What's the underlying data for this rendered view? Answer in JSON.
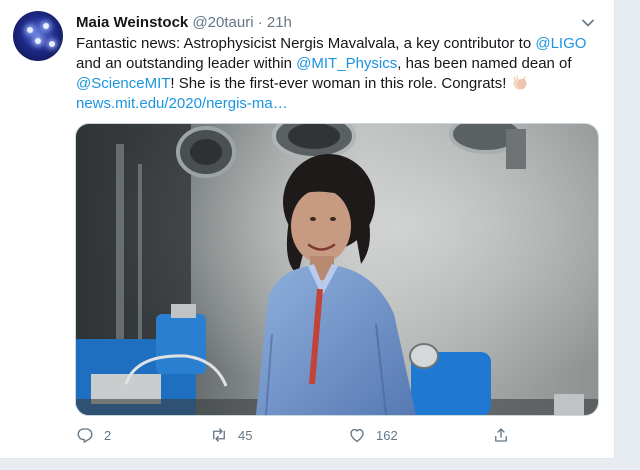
{
  "tweet": {
    "author_name": "Maia Weinstock",
    "author_handle": "@20tauri",
    "separator": "·",
    "time": "21h",
    "text": {
      "part1": "Fantastic news: Astrophysicist Nergis Mavalvala, a key contributor to ",
      "mention1": "@LIGO",
      "part2": " and an outstanding leader within ",
      "mention2": "@MIT_Physics",
      "part3": ", has been named dean of ",
      "mention3": "@ScienceMIT",
      "part4": "! She is the first-ever woman in this role. Congrats! ",
      "link": "news.mit.edu/2020/nergis-ma…"
    },
    "media_icon": "photo-woman-in-lab",
    "actions": {
      "reply_count": "2",
      "retweet_count": "45",
      "like_count": "162"
    }
  },
  "colors": {
    "link": "#1b95e0",
    "secondary": "#657786",
    "primary_text": "#14171a"
  }
}
